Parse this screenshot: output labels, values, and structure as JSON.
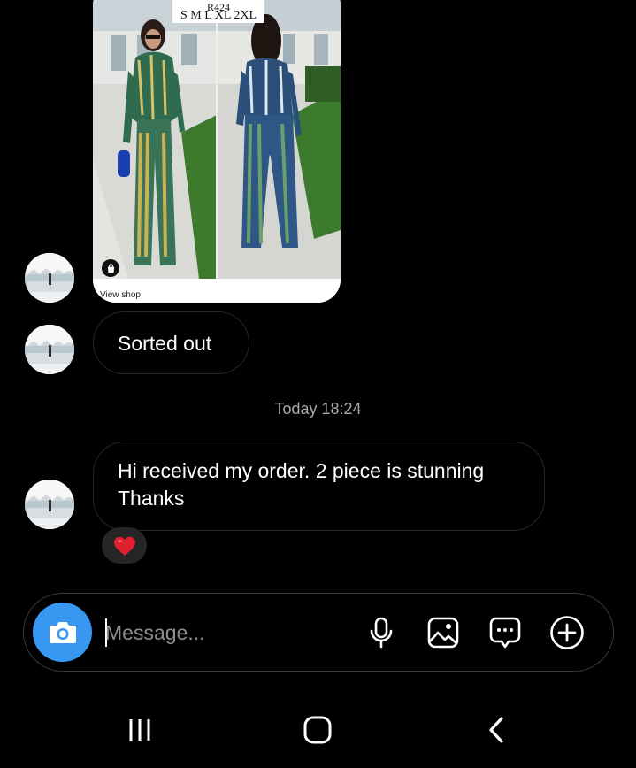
{
  "shared_post": {
    "product_code": "R424",
    "sizes": "S M L XL 2XL",
    "footer_text": "View shop"
  },
  "messages": [
    {
      "text": "Sorted  out"
    },
    {
      "text": "Hi received  my order. 2 piece  is stunning\nThanks",
      "reaction": "red-heart-emoji"
    }
  ],
  "timestamp": "Today 18:24",
  "composer": {
    "placeholder": "Message..."
  },
  "icons": {
    "camera": "camera-icon",
    "mic": "microphone-icon",
    "gallery": "gallery-icon",
    "sticker": "sticker-icon",
    "add": "add-icon"
  },
  "colors": {
    "accent": "#3897f0",
    "reaction_heart": "#e0202e",
    "timestamp": "#a8a8a8"
  }
}
